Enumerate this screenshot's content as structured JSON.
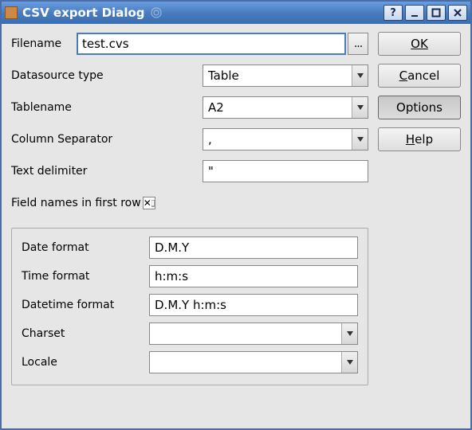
{
  "window": {
    "title": "CSV export Dialog"
  },
  "buttons": {
    "ok": "OK",
    "cancel": "Cancel",
    "options": "Options",
    "help": "Help",
    "browse": "..."
  },
  "labels": {
    "filename": "Filename",
    "datasource_type": "Datasource type",
    "tablename": "Tablename",
    "column_separator": "Column Separator",
    "text_delimiter": "Text delimiter",
    "field_names": "Field names in first row",
    "date_format": "Date format",
    "time_format": "Time format",
    "datetime_format": "Datetime format",
    "charset": "Charset",
    "locale": "Locale"
  },
  "values": {
    "filename": "test.cvs",
    "datasource_type": "Table",
    "tablename": "A2",
    "column_separator": ",",
    "text_delimiter": "\"",
    "field_names_checked": true,
    "date_format": "D.M.Y",
    "time_format": "h:m:s",
    "datetime_format": "D.M.Y h:m:s",
    "charset": "",
    "locale": ""
  }
}
